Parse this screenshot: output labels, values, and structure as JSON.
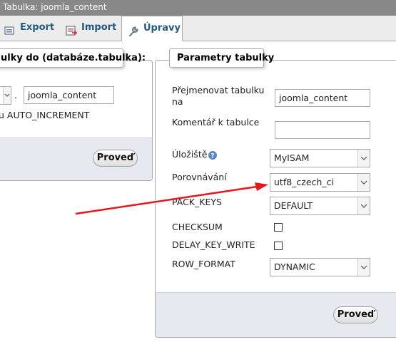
{
  "title": "Tabulka: joomla_content",
  "tabs": [
    {
      "label": "Export",
      "icon": "export-icon"
    },
    {
      "label": "Import",
      "icon": "import-icon"
    },
    {
      "label": "Úpravy",
      "icon": "wrench-icon",
      "active": true
    }
  ],
  "move_panel": {
    "legend": "ulky do (databáze.tabulka):",
    "dot": ".",
    "table_name": "joomla_content",
    "auto_increment_label": "u AUTO_INCREMENT",
    "submit": "Proveď"
  },
  "params_panel": {
    "legend": "Parametry tabulky",
    "rename_label_line1": "Přejmenovat tabulku",
    "rename_label_line2": "na",
    "rename_value": "joomla_content",
    "comment_label": "Komentář k tabulce",
    "comment_value": "",
    "storage_label": "Úložiště",
    "storage_value": "MyISAM",
    "collation_label": "Porovnávání",
    "collation_value": "utf8_czech_ci",
    "pack_keys_label": "PACK_KEYS",
    "pack_keys_value": "DEFAULT",
    "checksum_label": "CHECKSUM",
    "checksum_checked": false,
    "delay_key_write_label": "DELAY_KEY_WRITE",
    "delay_key_write_checked": false,
    "row_format_label": "ROW_FORMAT",
    "row_format_value": "DYNAMIC",
    "submit": "Proveď"
  },
  "annotation": {
    "color": "#e8151b"
  }
}
